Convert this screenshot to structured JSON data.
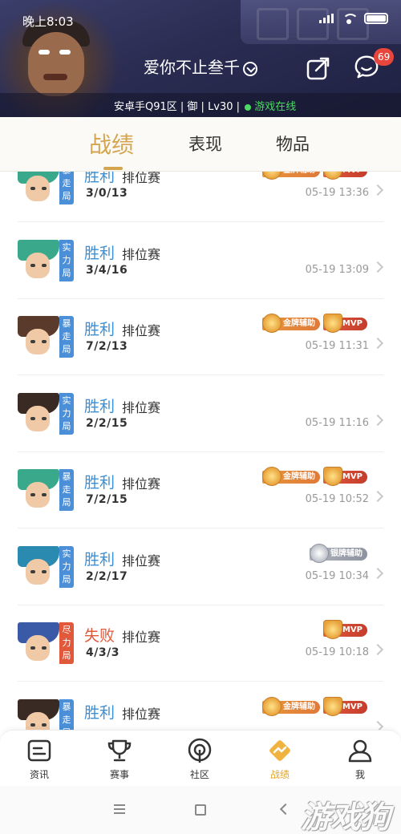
{
  "status_bar": {
    "time": "晚上8:03"
  },
  "header": {
    "player_name": "爱你不止叁千",
    "message_badge": "69",
    "server_info": "安卓手Q91区 | 御 | Lv30 |",
    "online_status": "游戏在线"
  },
  "tabs": [
    "战绩",
    "表现",
    "物品"
  ],
  "matches": [
    {
      "mode": "暴走局",
      "mode_color": "#4a8fd8",
      "result": "胜利",
      "result_type": "win",
      "match_type": "排位赛",
      "kda": "3/0/13",
      "time": "05-19 13:36",
      "badges": [
        {
          "type": "gold",
          "label": "金牌辅助"
        },
        {
          "type": "mvp",
          "label": "MVP"
        }
      ],
      "hero_hair": "#3aa88a"
    },
    {
      "mode": "实力局",
      "mode_color": "#4a8fd8",
      "result": "胜利",
      "result_type": "win",
      "match_type": "排位赛",
      "kda": "3/4/16",
      "time": "05-19 13:09",
      "badges": [],
      "hero_hair": "#3aa88a"
    },
    {
      "mode": "暴走局",
      "mode_color": "#4a8fd8",
      "result": "胜利",
      "result_type": "win",
      "match_type": "排位赛",
      "kda": "7/2/13",
      "time": "05-19 11:31",
      "badges": [
        {
          "type": "gold",
          "label": "金牌辅助"
        },
        {
          "type": "mvp",
          "label": "MVP"
        }
      ],
      "hero_hair": "#5a3a2a"
    },
    {
      "mode": "实力局",
      "mode_color": "#4a8fd8",
      "result": "胜利",
      "result_type": "win",
      "match_type": "排位赛",
      "kda": "2/2/15",
      "time": "05-19 11:16",
      "badges": [],
      "hero_hair": "#3a2a24"
    },
    {
      "mode": "暴走局",
      "mode_color": "#4a8fd8",
      "result": "胜利",
      "result_type": "win",
      "match_type": "排位赛",
      "kda": "7/2/15",
      "time": "05-19 10:52",
      "badges": [
        {
          "type": "gold",
          "label": "金牌辅助"
        },
        {
          "type": "mvp",
          "label": "MVP"
        }
      ],
      "hero_hair": "#3aa88a"
    },
    {
      "mode": "实力局",
      "mode_color": "#4a8fd8",
      "result": "胜利",
      "result_type": "win",
      "match_type": "排位赛",
      "kda": "2/2/17",
      "time": "05-19 10:34",
      "badges": [
        {
          "type": "silver",
          "label": "银牌辅助"
        }
      ],
      "hero_hair": "#2a8ab0"
    },
    {
      "mode": "尽力局",
      "mode_color": "#e2583a",
      "result": "失败",
      "result_type": "lose",
      "match_type": "排位赛",
      "kda": "4/3/3",
      "time": "05-19 10:18",
      "badges": [
        {
          "type": "mvp",
          "label": "MVP"
        }
      ],
      "hero_hair": "#3a5aa8"
    },
    {
      "mode": "暴走局",
      "mode_color": "#4a8fd8",
      "result": "胜利",
      "result_type": "win",
      "match_type": "排位赛",
      "kda": "",
      "time": "",
      "badges": [
        {
          "type": "gold",
          "label": "金牌辅助"
        },
        {
          "type": "mvp",
          "label": "MVP"
        }
      ],
      "hero_hair": "#3a2a24"
    }
  ],
  "bottom_nav": [
    {
      "label": "资讯",
      "icon": "news-icon",
      "active": false
    },
    {
      "label": "赛事",
      "icon": "trophy-icon",
      "active": false
    },
    {
      "label": "社区",
      "icon": "community-icon",
      "active": false
    },
    {
      "label": "战绩",
      "icon": "record-icon",
      "active": true
    },
    {
      "label": "我",
      "icon": "profile-icon",
      "active": false
    }
  ],
  "watermark": "游戏狗"
}
